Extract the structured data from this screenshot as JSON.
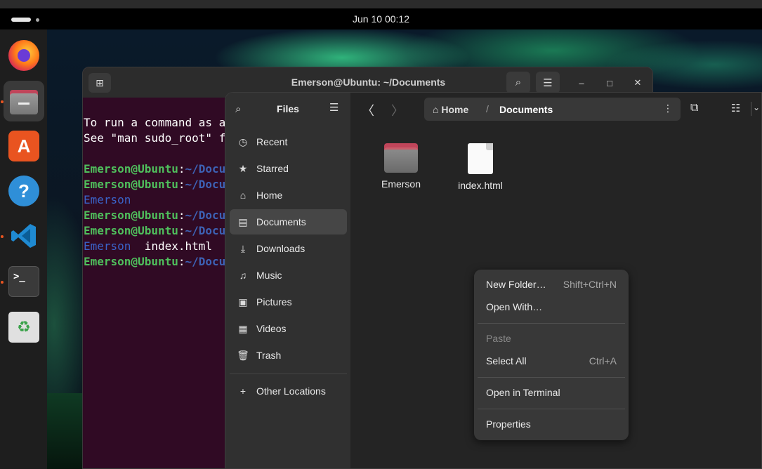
{
  "topbar": {
    "clock": "Jun 10  00:12"
  },
  "dock": {
    "items": [
      {
        "name": "firefox",
        "icon": "firefox-icon"
      },
      {
        "name": "files",
        "icon": "folder-icon"
      },
      {
        "name": "app-center",
        "icon": "app-center-icon",
        "glyph": "A"
      },
      {
        "name": "help",
        "icon": "help-icon",
        "glyph": "?"
      },
      {
        "name": "vscode",
        "icon": "vscode-icon"
      },
      {
        "name": "terminal",
        "icon": "terminal-icon",
        "glyph": ">_"
      },
      {
        "name": "trash",
        "icon": "trash-icon",
        "glyph": "♻"
      }
    ]
  },
  "terminal": {
    "title": "Emerson@Ubuntu: ~/Documents",
    "lines": [
      {
        "text": "To run a command as a"
      },
      {
        "text": "See \"man sudo_root\" f"
      },
      {
        "text": ""
      },
      {
        "user": "Emerson@Ubuntu",
        "sep": ":",
        "path": "~/Docu"
      },
      {
        "user": "Emerson@Ubuntu",
        "sep": ":",
        "path": "~/Docu"
      },
      {
        "dir": "Emerson"
      },
      {
        "user": "Emerson@Ubuntu",
        "sep": ":",
        "path": "~/Docu"
      },
      {
        "user": "Emerson@Ubuntu",
        "sep": ":",
        "path": "~/Docu"
      },
      {
        "dir": "Emerson",
        "file": "  index.html"
      },
      {
        "user": "Emerson@Ubuntu",
        "sep": ":",
        "path": "~/Docu"
      }
    ]
  },
  "files": {
    "sidebar_title": "Files",
    "sidebar": [
      {
        "label": "Recent",
        "icon": "clock-icon",
        "glyph": "◷"
      },
      {
        "label": "Starred",
        "icon": "star-icon",
        "glyph": "★"
      },
      {
        "label": "Home",
        "icon": "home-icon",
        "glyph": "⌂"
      },
      {
        "label": "Documents",
        "icon": "document-icon",
        "glyph": "▤",
        "selected": true
      },
      {
        "label": "Downloads",
        "icon": "download-icon",
        "glyph": "⤓"
      },
      {
        "label": "Music",
        "icon": "music-icon",
        "glyph": "♫"
      },
      {
        "label": "Pictures",
        "icon": "picture-icon",
        "glyph": "▣"
      },
      {
        "label": "Videos",
        "icon": "video-icon",
        "glyph": "▦"
      },
      {
        "label": "Trash",
        "icon": "trash-icon",
        "glyph": "🗑"
      }
    ],
    "other_locations": "Other Locations",
    "path": {
      "home": "Home",
      "separator": "/",
      "current": "Documents"
    },
    "items": [
      {
        "name": "Emerson",
        "type": "folder"
      },
      {
        "name": "index.html",
        "type": "file"
      }
    ]
  },
  "context_menu": {
    "new_folder": "New Folder…",
    "new_folder_shortcut": "Shift+Ctrl+N",
    "open_with": "Open With…",
    "paste": "Paste",
    "select_all": "Select All",
    "select_all_shortcut": "Ctrl+A",
    "open_in_terminal": "Open in Terminal",
    "properties": "Properties"
  }
}
